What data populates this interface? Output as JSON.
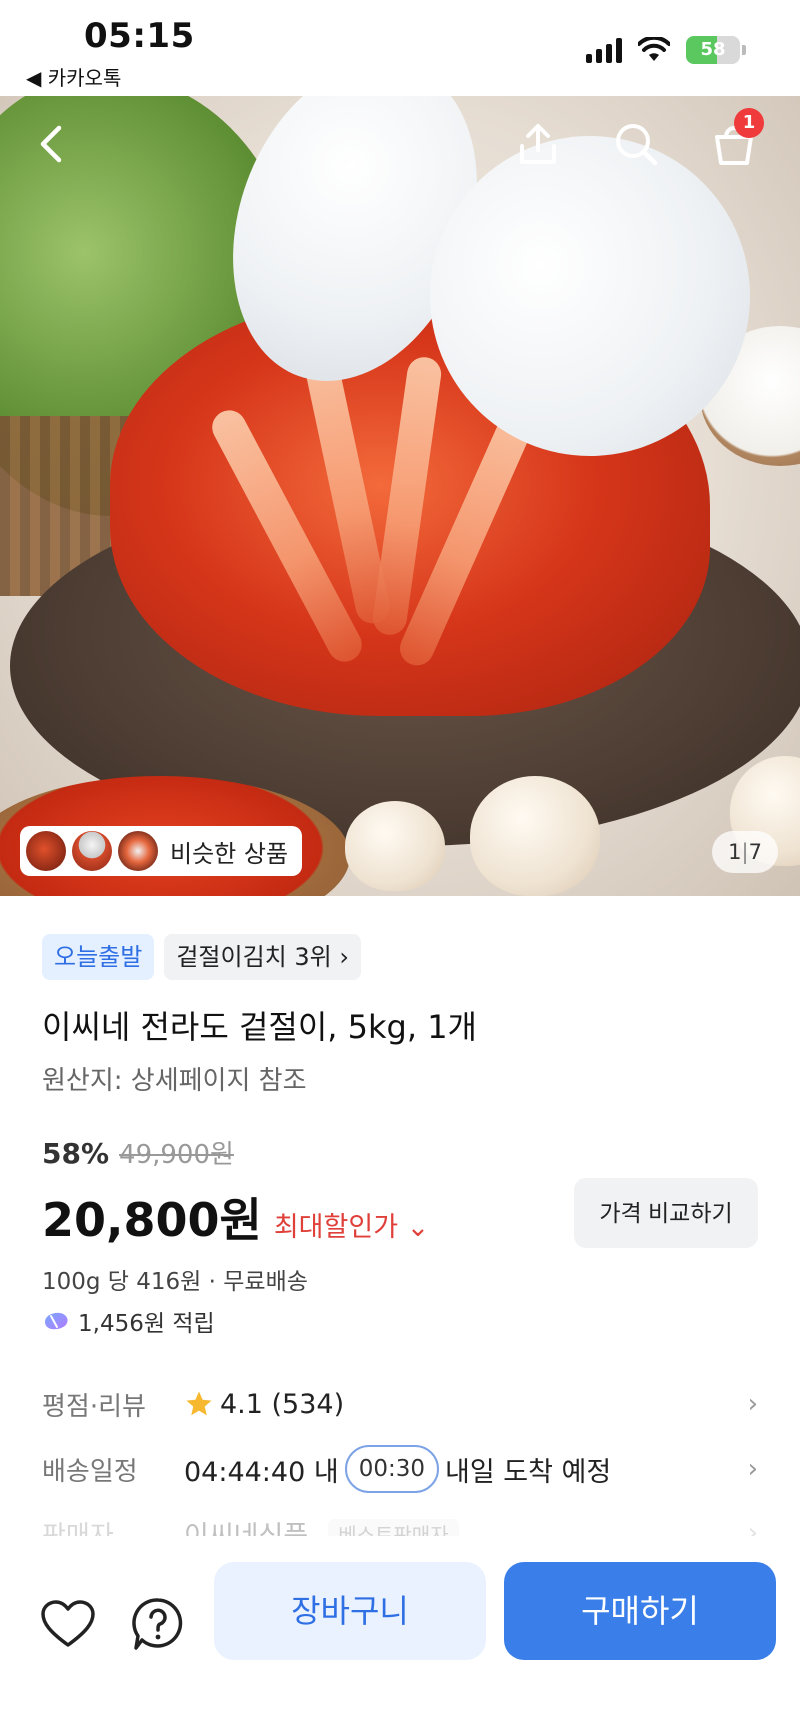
{
  "status_bar": {
    "time": "05:15",
    "back_app": "◀ 카카오톡",
    "battery_percent": 58,
    "battery_label": "58"
  },
  "header": {
    "back_icon": "chevron-left-icon",
    "share_icon": "share-icon",
    "search_icon": "search-icon",
    "cart_icon": "cart-icon",
    "cart_badge": "1"
  },
  "gallery": {
    "similar_label": "비슷한 상품",
    "current_page": "1",
    "separator": "|",
    "total_pages": "7"
  },
  "product": {
    "tags": [
      "오늘출발",
      "겉절이김치 3위 ›"
    ],
    "title": "이씨네 전라도 겉절이, 5kg, 1개",
    "origin": "원산지: 상세페이지 참조",
    "discount": "58%",
    "original_price": "49,900원",
    "price": "20,800원",
    "max_discount_label": "최대할인가 ⌄",
    "compare_button": "가격 비교하기",
    "unit_price": "100g 당 416원 · 무료배송",
    "points": "1,456원 적립"
  },
  "info": {
    "rating_label": "평점·리뷰",
    "rating_value": "4.1 (534)",
    "delivery_label": "배송일정",
    "delivery_countdown": "04:44:40 내",
    "delivery_timer": "00:30",
    "delivery_arrival": "내일 도착 예정",
    "seller_label": "판매자",
    "seller_value": "이씨네식품",
    "seller_badge": "베스트판매자",
    "arrow": "›"
  },
  "bottom_bar": {
    "wishlist_icon": "heart-icon",
    "help_icon": "question-icon",
    "cart_button": "장바구니",
    "buy_button": "구매하기"
  },
  "colors": {
    "accent_blue": "#3a7fe9",
    "discount_red": "#e0403a",
    "badge_red": "#ef3b3b",
    "star_yellow": "#f5b82e",
    "battery_green": "#5ac85f"
  }
}
